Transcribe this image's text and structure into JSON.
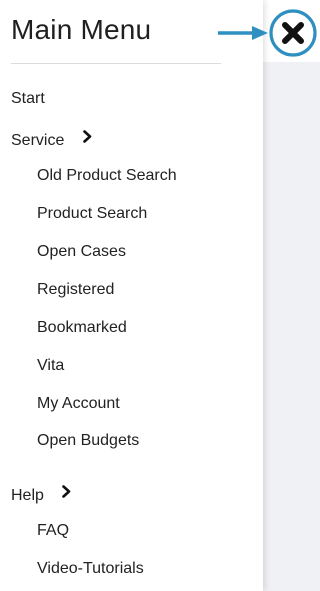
{
  "menu": {
    "title": "Main Menu",
    "close_icon": "close-x-icon",
    "pointer_icon": "arrow-right-icon",
    "accent_color": "#2e8fc0"
  },
  "items": [
    {
      "label": "Start",
      "level": "top"
    },
    {
      "label": "Service",
      "level": "top",
      "chevron": true
    },
    {
      "label": "Old Product Search",
      "level": "sub"
    },
    {
      "label": "Product Search",
      "level": "sub"
    },
    {
      "label": "Open Cases",
      "level": "sub"
    },
    {
      "label": "Registered",
      "level": "sub"
    },
    {
      "label": "Bookmarked",
      "level": "sub"
    },
    {
      "label": "Vita",
      "level": "sub"
    },
    {
      "label": "My Account",
      "level": "sub"
    },
    {
      "label": "Open Budgets",
      "level": "sub"
    },
    {
      "label": "Help",
      "level": "top",
      "chevron": true
    },
    {
      "label": "FAQ",
      "level": "sub"
    },
    {
      "label": "Video-Tutorials",
      "level": "sub"
    }
  ]
}
